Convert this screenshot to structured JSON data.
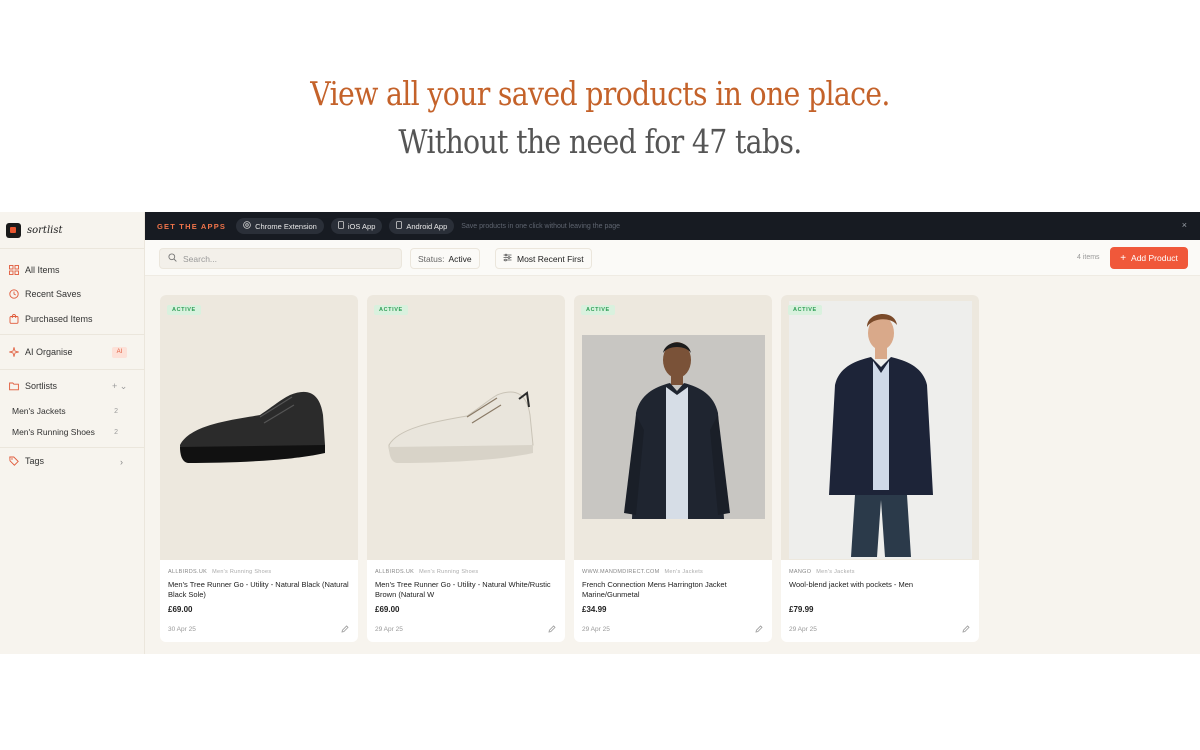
{
  "hero": {
    "line1": "View all your saved products in one place.",
    "line2": "Without the need for 47 tabs."
  },
  "brand": {
    "name": "sortlist",
    "icon": "sortlist-logo-icon"
  },
  "sidebar": {
    "items": [
      {
        "label": "All Items",
        "icon": "grid-icon"
      },
      {
        "label": "Recent Saves",
        "icon": "clock-icon"
      },
      {
        "label": "Purchased Items",
        "icon": "bag-icon"
      },
      {
        "label": "AI Organise",
        "icon": "sparkle-icon",
        "badge": "AI"
      },
      {
        "label": "Sortlists",
        "icon": "folder-icon",
        "controls": "+ ⌄"
      },
      {
        "label": "Tags",
        "icon": "tag-icon"
      }
    ],
    "sortlists": [
      {
        "label": "Men's Jackets",
        "count": "2"
      },
      {
        "label": "Men's Running Shoes",
        "count": "2"
      }
    ]
  },
  "banner": {
    "label": "GET THE APPS",
    "buttons": [
      {
        "label": "Chrome Extension",
        "icon": "chrome-icon"
      },
      {
        "label": "iOS App",
        "icon": "phone-icon"
      },
      {
        "label": "Android App",
        "icon": "phone-icon"
      }
    ],
    "note": "Save products in one click without leaving the page",
    "close": "×"
  },
  "toolbar": {
    "search_placeholder": "Search...",
    "status_label": "Status:",
    "status_value": "Active",
    "sort_label": "Most Recent First",
    "count": "4 items",
    "add_label": "Add Product"
  },
  "colors": {
    "accent": "#f0583a",
    "heading": "#c4622a",
    "banner_bg": "#171b22",
    "active_badge": "#2e9e55"
  },
  "cards": [
    {
      "badge": "ACTIVE",
      "store": "ALLBIRDS.UK",
      "category": "Men's Running Shoes",
      "title": "Men's Tree Runner Go - Utility - Natural Black (Natural Black Sole)",
      "price": "£69.00",
      "date": "30 Apr 25"
    },
    {
      "badge": "ACTIVE",
      "store": "ALLBIRDS.UK",
      "category": "Men's Running Shoes",
      "title": "Men's Tree Runner Go - Utility - Natural White/Rustic Brown (Natural W",
      "price": "£69.00",
      "date": "29 Apr 25"
    },
    {
      "badge": "ACTIVE",
      "store": "WWW.MANDMDIRECT.COM",
      "category": "Men's Jackets",
      "title": "French Connection Mens Harrington Jacket Marine/Gunmetal",
      "price": "£34.99",
      "date": "29 Apr 25"
    },
    {
      "badge": "ACTIVE",
      "store": "MANGO",
      "category": "Men's Jackets",
      "title": "Wool-blend jacket with pockets - Men",
      "price": "£79.99",
      "date": "29 Apr 25"
    }
  ]
}
